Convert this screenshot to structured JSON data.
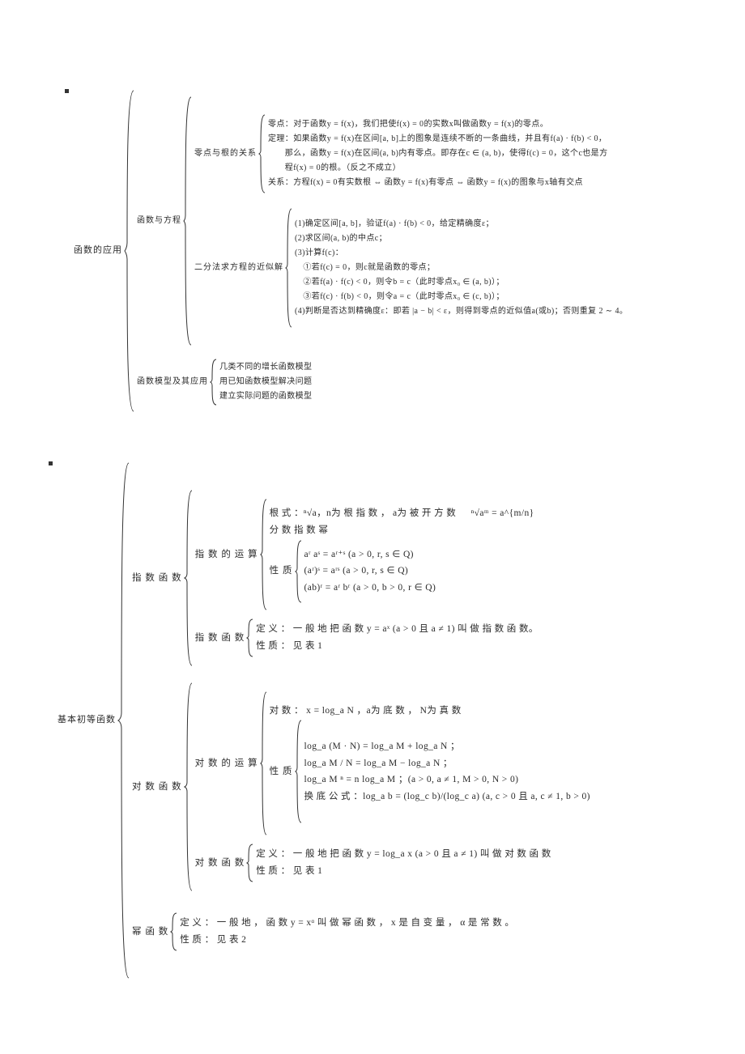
{
  "top": {
    "root_label": "函数的应用",
    "branch1": {
      "label": "函数与方程",
      "sub1": {
        "label": "零点与根的关系",
        "lines": [
          "零点：对于函数y = f(x)，我们把使f(x) = 0的实数x叫做函数y = f(x)的零点。",
          "定理：如果函数y = f(x)在区间[a, b]上的图象是连续不断的一条曲线，并且有f(a) · f(b) < 0，",
          "  那么，函数y = f(x)在区间(a, b)内有零点。即存在c ∈ (a, b)，使得f(c) = 0，这个c也是方",
          "  程f(x) = 0的根。（反之不成立）",
          "关系：方程f(x) = 0有实数根 ⇔ 函数y = f(x)有零点 ⇔ 函数y = f(x)的图象与x轴有交点"
        ]
      },
      "sub2": {
        "label": "二分法求方程的近似解",
        "lines": [
          "(1)确定区间[a, b]，验证f(a) · f(b) < 0，给定精确度ε；",
          "(2)求区间(a, b)的中点c；",
          "(3)计算f(c)：",
          " ①若f(c) = 0，则c就是函数的零点；",
          " ②若f(a) · f(c) < 0，则令b = c（此时零点x₀ ∈ (a, b)）；",
          " ③若f(c) · f(b) < 0，则令a = c（此时零点x₀ ∈ (c, b)）；",
          "(4)判断是否达到精确度ε：即若 |a − b| < ε，则得到零点的近似值a(或b)；否则重复 2 ∼ 4。"
        ]
      }
    },
    "branch2": {
      "label": "函数模型及其应用",
      "lines": [
        "几类不同的增长函数模型",
        "用已知函数模型解决问题",
        "建立实际问题的函数模型"
      ]
    }
  },
  "bottom": {
    "root_label": "基本初等函数",
    "exp": {
      "label": "指 数 函 数",
      "ops_label": "指 数 的 运 算",
      "ops_lines": [
        "根 式 ：ⁿ√a，n为 根 指 数 ， a为 被 开 方 数   ⁿ√aᵐ = a^{m/n}",
        "分 数 指 数 幂"
      ],
      "prop_label": "性 质",
      "prop_lines": [
        "aʳ aˢ = aʳ⁺ˢ (a > 0, r, s ∈ Q)",
        "(aʳ)ˢ = aʳˢ (a > 0, r, s ∈ Q)",
        "(ab)ʳ = aʳ bʳ (a > 0, b > 0, r ∈ Q)"
      ],
      "fn_label": "指 数 函 数",
      "fn_lines": [
        "定 义 ： 一 般 地 把 函 数 y = aˣ (a > 0 且 a ≠ 1) 叫 做 指 数 函 数。",
        "性 质 ： 见 表 1"
      ]
    },
    "log": {
      "label": "对 数 函 数",
      "ops_label": "对 数 的 运 算",
      "head_line": "对 数 ： x = log_a N ，a为 底 数 ， N为 真 数",
      "prop_label": "性 质",
      "prop_lines": [
        "log_a (M · N) = log_a M + log_a N ；",
        "log_a  M / N  = log_a M − log_a N ；",
        "log_a M ⁿ = n log_a M ；(a > 0, a ≠ 1, M > 0, N > 0)",
        "换 底 公 式 ：log_a b = (log_c b)/(log_c a) (a, c > 0 且 a, c ≠ 1, b > 0)"
      ],
      "fn_label": "对 数 函 数",
      "fn_lines": [
        "定 义 ： 一 般 地 把 函 数 y = log_a x (a > 0 且 a ≠ 1) 叫 做 对 数 函 数",
        "性 质 ： 见 表 1"
      ]
    },
    "pow": {
      "label": "幂 函 数",
      "lines": [
        "定 义 ： 一 般 地 ， 函 数 y = xᵅ 叫 做 幂 函 数 ， x 是 自 变 量 ， α 是 常 数 。",
        "性 质 ： 见 表 2"
      ]
    }
  }
}
